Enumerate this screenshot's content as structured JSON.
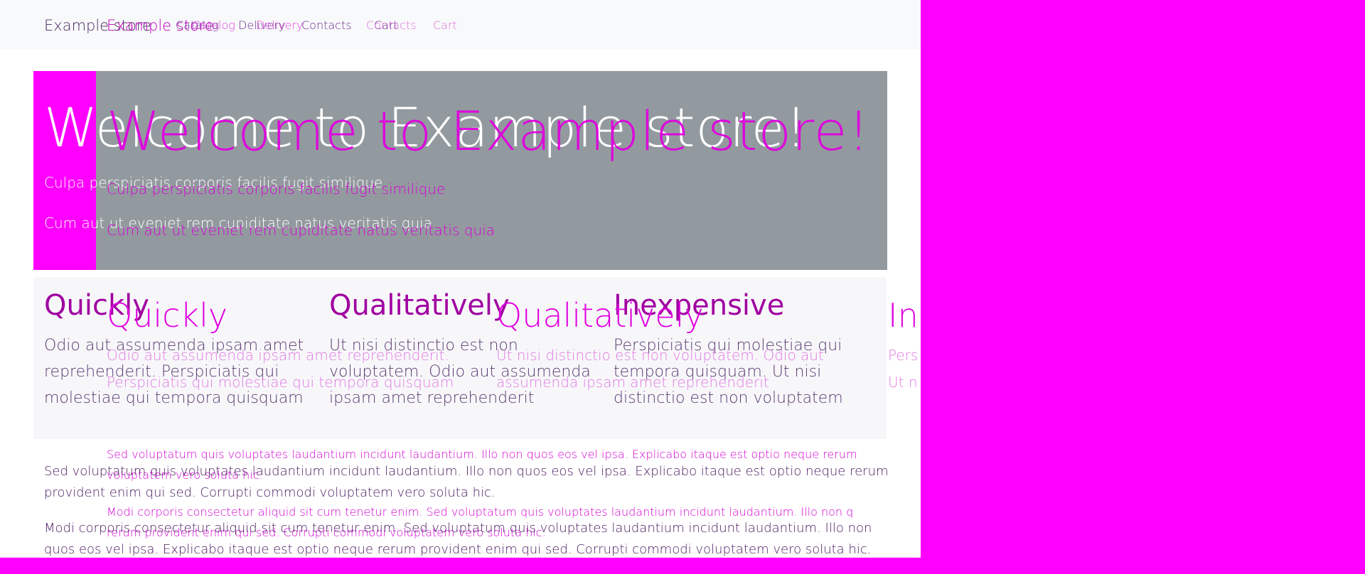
{
  "nav": {
    "brand": "Example store",
    "items": [
      "Catalog",
      "Delivery",
      "Contacts",
      "Cart"
    ]
  },
  "hero": {
    "title": "Welcome to Example store!",
    "lines": [
      "Culpa perspiciatis corporis facilis fugit similique",
      "Cum aut ut eveniet rem cupiditate natus veritatis quia"
    ]
  },
  "features": [
    {
      "title": "Quickly",
      "text_lines": [
        "Odio aut assumenda ipsam amet",
        "reprehenderit. Perspiciatis qui",
        "molestiae qui tempora quisquam"
      ]
    },
    {
      "title": "Qualitatively",
      "text_lines": [
        "Ut nisi distinctio est non",
        "voluptatem. Odio aut assumenda",
        "ipsam amet reprehenderit"
      ]
    },
    {
      "title": "Inexpensive",
      "text_lines": [
        "Perspiciatis qui molestiae qui",
        "tempora quisquam. Ut nisi",
        "distinctio est non voluptatem"
      ]
    }
  ],
  "ghost": {
    "features": [
      {
        "title": "Quickly",
        "text": "Odio aut assumenda ipsam amet reprehenderit.",
        "text2": "Perspiciatis qui molestiae qui tempora quisquam"
      },
      {
        "title": "Qualitatively",
        "text": "Ut nisi distinctio est non voluptatem. Odio aut",
        "text2": "assumenda ipsam amet reprehenderit"
      },
      {
        "title": "In",
        "text": "Pers",
        "text2": "Ut n"
      }
    ],
    "paragraphs": [
      {
        "line1": "Sed voluptatum quis voluptates laudantium incidunt laudantium. Illo non quos eos vel ipsa. Explicabo itaque est optio neque rerum",
        "line2": "voluptatem vero soluta hic."
      },
      {
        "line1": "Modi corporis consectetur aliquid sit cum tenetur enim. Sed voluptatum quis voluptates laudantium incidunt laudantium. Illo non q",
        "line2": "rerum provident enim qui sed. Corrupti commodi voluptatem vero soluta hic."
      }
    ]
  },
  "paragraphs": [
    {
      "line1": "Sed voluptatum quis voluptates laudantium incidunt laudantium. Illo non quos eos vel ipsa. Explicabo itaque est optio neque rerum",
      "line2": "provident enim qui sed. Corrupti commodi voluptatem vero soluta hic."
    },
    {
      "line1": "Modi corporis consectetur aliquid sit cum tenetur enim. Sed voluptatum quis voluptates laudantium incidunt laudantium. Illo non",
      "line2": "quos eos vel ipsa. Explicabo itaque est optio neque rerum provident enim qui sed. Corrupti commodi voluptatem vero soluta hic."
    }
  ],
  "colors": {
    "background": "#ff00ff",
    "hero_gray": "#939a9f",
    "navbar": "#f8f9fa",
    "text_dark": "#3a1f4f",
    "ghost_text": "#e100e1"
  }
}
